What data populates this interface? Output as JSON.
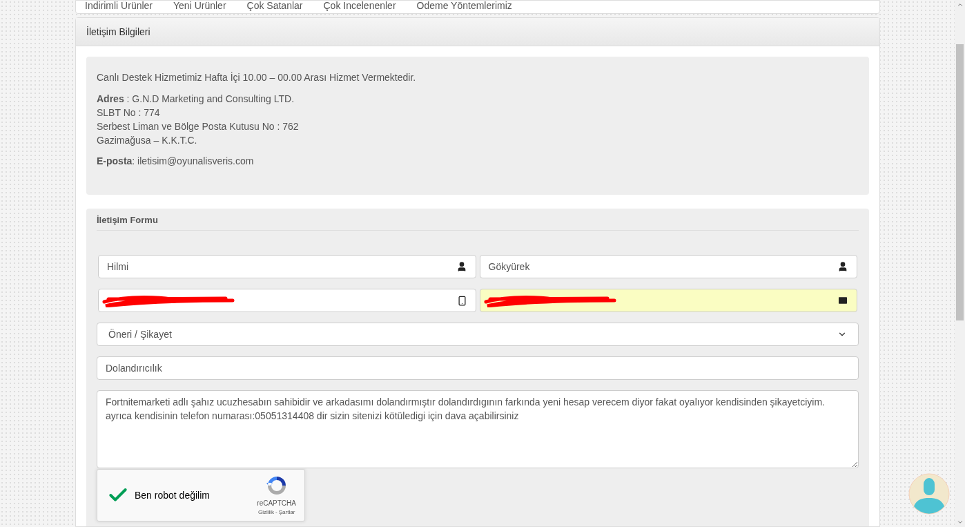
{
  "nav": [
    "İndirimli Ürünler",
    "Yeni Ürünler",
    "Çok Satanlar",
    "Çok İncelenenler",
    "Ödeme Yöntemlerimiz"
  ],
  "panel": {
    "title": "İletişim Bilgileri"
  },
  "info": {
    "notice": "Canlı Destek Hizmetimiz Hafta İçi 10.00 – 00.00 Arası Hizmet Vermektedir.",
    "address": [
      "**Adres** : G.N.D Marketing and Consulting LTD.",
      "SLBT No : 774",
      "Serbest Liman ve Bölge Posta Kutusu No : 762",
      "Gazimağusa – K.K.T.C."
    ],
    "email": "**E-posta**: iletisim@oyunalisveris.com"
  },
  "form": {
    "title": "İletişim Formu",
    "fields": [
      {
        "kind": "name",
        "value": "Hilmi",
        "autofilled": false
      },
      {
        "kind": "name",
        "value": "Gökyürek",
        "autofilled": false
      },
      {
        "kind": "phone",
        "redacted": true,
        "autofilled": false
      },
      {
        "kind": "email",
        "redacted": true,
        "autofilled": true
      }
    ],
    "subject": {
      "value": "Öneri / Şikayet"
    },
    "topic": {
      "value": "Dolandırıcılık"
    },
    "message": {
      "value": "Fortnitemarketi adlı şahız ucuzhesabın sahibidir ve arkadasımı dolandırmıştır dolandırdıgının farkında yeni hesap verecem diyor fakat oyalıyor kendisinden şikayetciyim.\nayrıca kendisinin telefon numarası:05051314408 dir sizin sitenizi kötüledigi için dava açabilirsiniz"
    },
    "captcha": {
      "checked": true,
      "label": "Ben robot değilim",
      "brand": "reCAPTCHA",
      "links": [
        "Gizlilik",
        "Şartlar"
      ],
      "separator": "-"
    }
  }
}
